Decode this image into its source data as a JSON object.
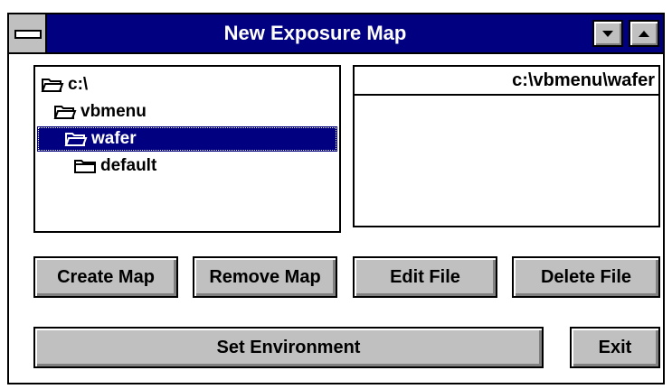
{
  "window": {
    "title": "New Exposure Map"
  },
  "dir_tree": {
    "items": [
      {
        "label": "c:\\",
        "level": 0,
        "selected": false,
        "open": true
      },
      {
        "label": "vbmenu",
        "level": 1,
        "selected": false,
        "open": true
      },
      {
        "label": "wafer",
        "level": 2,
        "selected": true,
        "open": true
      },
      {
        "label": "default",
        "level": 3,
        "selected": false,
        "open": false
      }
    ]
  },
  "file_list": {
    "header": "c:\\vbmenu\\wafer"
  },
  "buttons": {
    "create_map": "Create Map",
    "remove_map": "Remove Map",
    "edit_file": "Edit File",
    "delete_file": "Delete File",
    "set_environment": "Set Environment",
    "exit": "Exit"
  },
  "colors": {
    "titlebar": "#000080",
    "selection": "#000080",
    "button_face": "#c0c0c0"
  }
}
